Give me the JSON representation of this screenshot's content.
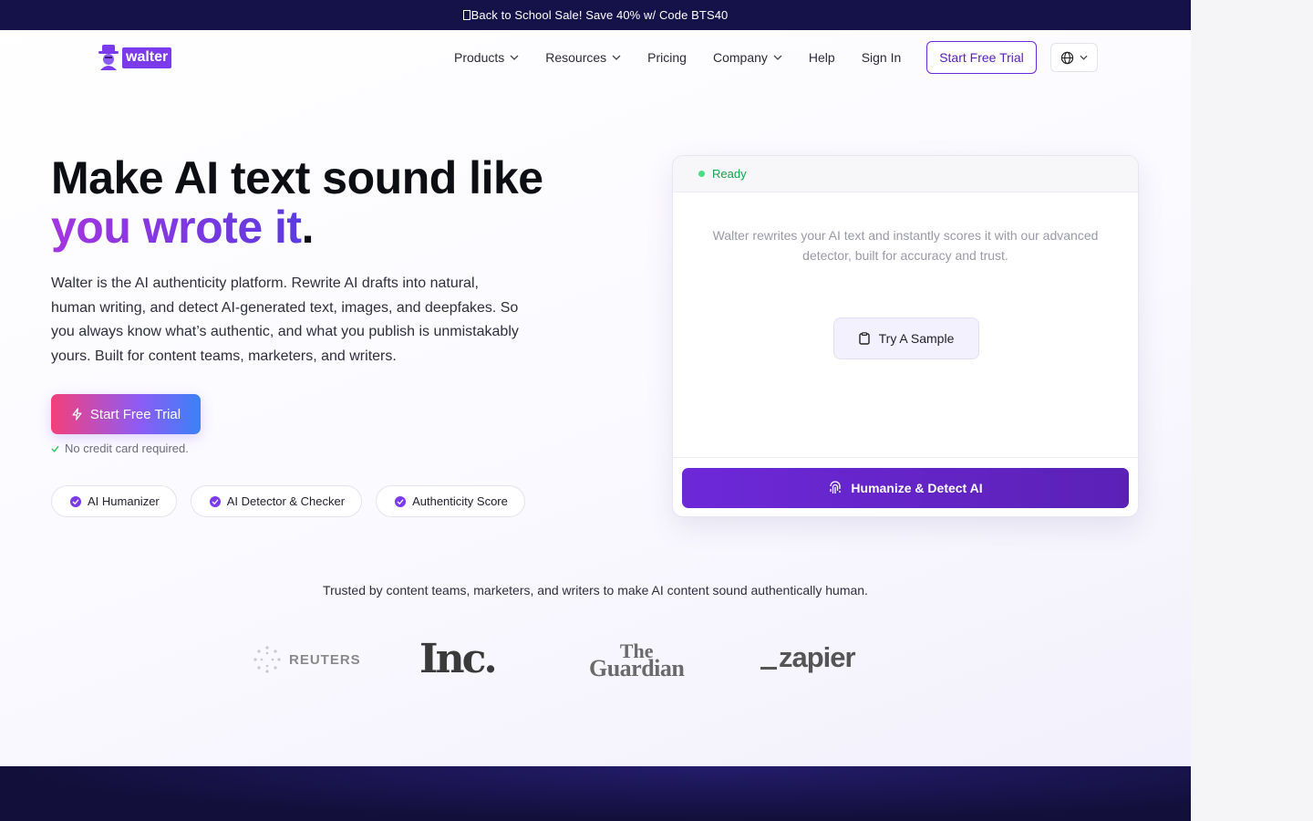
{
  "banner": {
    "text": "Back to School Sale! Save 40% w/ Code BTS40"
  },
  "logo": {
    "text": "walter"
  },
  "nav": {
    "items": [
      {
        "label": "Products",
        "dropdown": true
      },
      {
        "label": "Resources",
        "dropdown": true
      },
      {
        "label": "Pricing",
        "dropdown": false
      },
      {
        "label": "Company",
        "dropdown": true
      },
      {
        "label": "Help",
        "dropdown": false
      },
      {
        "label": "Sign In",
        "dropdown": false
      }
    ],
    "trial_label": "Start Free Trial",
    "language_icon": "globe-icon"
  },
  "hero": {
    "title_line1": "Make AI text sound like",
    "title_highlight": "you wrote it",
    "title_period": ".",
    "description": "Walter is the AI authenticity platform. Rewrite AI drafts into natural, human writing, and detect AI-generated text, images, and deepfakes. So you always know what’s authentic, and what you publish is unmistakably yours. Built for content teams, marketers, and writers.",
    "cta_label": "Start Free Trial",
    "no_credit_card": "No credit card required.",
    "chips": [
      "AI Humanizer",
      "AI Detector & Checker",
      "Authenticity Score"
    ]
  },
  "editor": {
    "status": "Ready",
    "placeholder": "Walter rewrites your AI text and instantly scores it with our advanced detector, built for accuracy and trust.",
    "sample_label": "Try A Sample",
    "humanize_label": "Humanize & Detect AI"
  },
  "trusted": {
    "text": "Trusted by content teams, marketers, and writers to make AI content sound authentically human.",
    "brands": {
      "reuters": "REUTERS",
      "inc": "Inc.",
      "guardian_top": "The",
      "guardian_bottom": "Guardian",
      "zapier": "zapier"
    }
  },
  "colors": {
    "brand_purple": "#7c3aed",
    "banner_bg": "#15124a",
    "status_green": "#16a34a"
  }
}
